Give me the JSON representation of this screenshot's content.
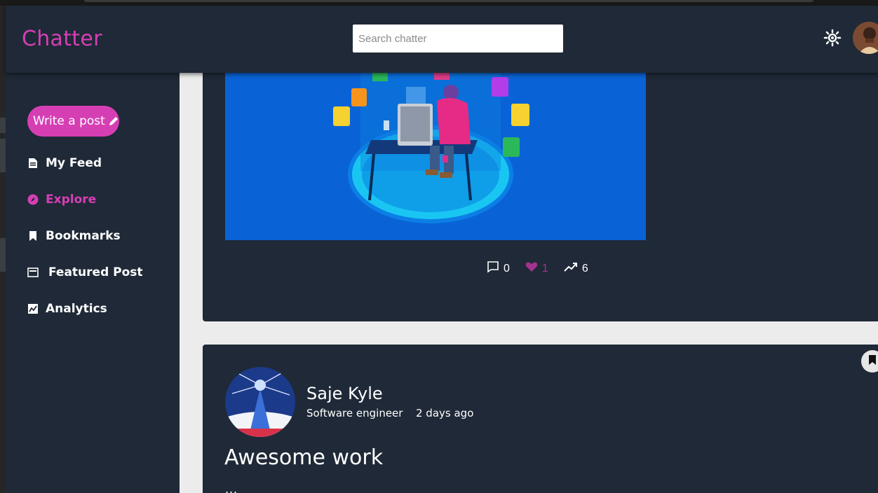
{
  "header": {
    "brand": "Chatter",
    "search_placeholder": "Search chatter",
    "theme_icon": "sun-icon",
    "avatar_icon": "user-avatar"
  },
  "sidebar": {
    "write_label": "Write a post",
    "items": [
      {
        "label": "My Feed",
        "icon": "feed-icon"
      },
      {
        "label": "Explore",
        "icon": "compass-icon"
      },
      {
        "label": "Bookmarks",
        "icon": "bookmark-icon"
      },
      {
        "label": "Featured Post",
        "icon": "featured-icon"
      },
      {
        "label": "Analytics",
        "icon": "analytics-icon"
      }
    ]
  },
  "feed": {
    "post1": {
      "image_icon": "developer-illustration",
      "comments": "0",
      "likes": "1",
      "views": "6"
    },
    "post2": {
      "author": "Saje Kyle",
      "role": "Software engineer",
      "time": "2 days ago",
      "title": "Awesome work",
      "more": "..."
    }
  },
  "colors": {
    "accent": "#d63fb4",
    "panel": "#1f2937",
    "background": "#ececec",
    "like": "#a2338c"
  }
}
